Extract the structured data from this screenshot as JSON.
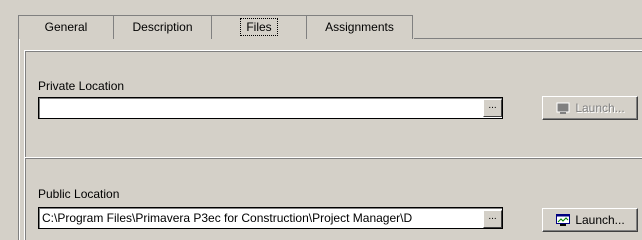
{
  "tabs": [
    {
      "label": "General"
    },
    {
      "label": "Description"
    },
    {
      "label": "Files"
    },
    {
      "label": "Assignments"
    }
  ],
  "active_tab": "Files",
  "private_location": {
    "label": "Private Location",
    "value": "",
    "browse_label": "...",
    "launch_label": "Launch...",
    "launch_enabled": false
  },
  "public_location": {
    "label": "Public Location",
    "value": "C:\\Program Files\\Primavera P3ec for Construction\\Project Manager\\D",
    "browse_label": "...",
    "launch_label": "Launch...",
    "launch_enabled": true
  },
  "icons": {
    "launch": "launch-window-icon"
  }
}
